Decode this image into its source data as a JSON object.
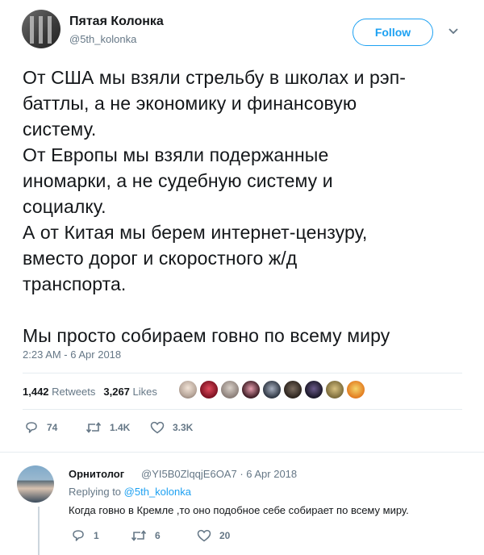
{
  "author": {
    "name": "Пятая Колонка",
    "handle": "@5th_kolonka"
  },
  "follow_label": "Follow",
  "tweet": {
    "text": "От США мы взяли стрельбу в школах и рэп-\nбаттлы, а не экономику и финансовую\nсистему.\nОт Европы мы взяли подержанные\nиномарки, а не судебную систему и\nсоциалку.\nА от Китая мы берем интернет-цензуру,\nвместо дорог и скоростного ж/д\nтранспорта.\n\nМы просто собираем говно по всему миру",
    "timestamp": "2:23 AM - 6 Apr 2018"
  },
  "stats": {
    "retweets_count": "1,442",
    "retweets_label": "Retweets",
    "likes_count": "3,267",
    "likes_label": "Likes"
  },
  "actions": {
    "replies": "74",
    "retweets": "1.4K",
    "likes": "3.3K"
  },
  "reply": {
    "name": "Орнитолог",
    "handle_date": "@YI5B0ZlqqjE6OA7 · 6 Apr 2018",
    "replying_prefix": "Replying to",
    "replying_to": "@5th_kolonka",
    "text": "Когда говно в Кремле ,то оно подобное себе собирает по всему миру.",
    "replies": "1",
    "retweets": "6",
    "likes": "20"
  },
  "colors": {
    "accent": "#1da1f2",
    "muted": "#657786",
    "text": "#14171a",
    "divider": "#e6ecf0"
  },
  "icons": [
    "caret-down-icon",
    "reply-icon",
    "retweet-icon",
    "like-icon"
  ]
}
